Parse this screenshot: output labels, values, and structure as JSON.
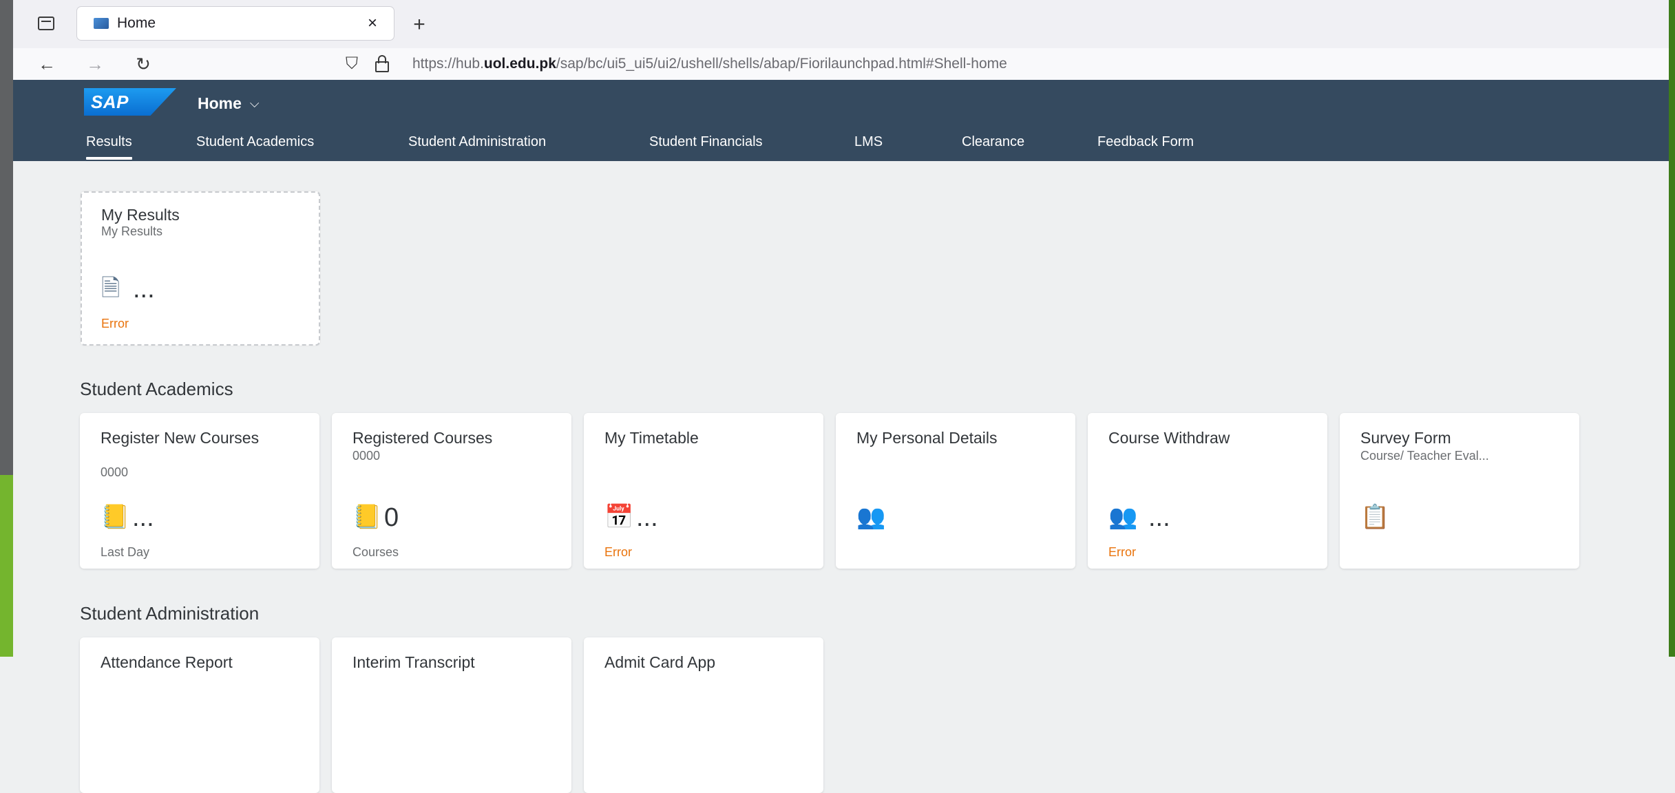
{
  "browser": {
    "tab_title": "Home",
    "tab_close": "×",
    "new_tab": "+",
    "back": "←",
    "forward": "→",
    "reload": "↻",
    "url_host": "https://hub.",
    "url_domain": "uol.edu.pk",
    "url_path": "/sap/bc/ui5_ui5/ui2/ushell/shells/abap/Fiorilaunchpad.html#Shell-home"
  },
  "shell": {
    "logo": "SAP",
    "home_label": "Home",
    "home_chevron": "⌵",
    "tabs": [
      {
        "label": "Results"
      },
      {
        "label": "Student Academics"
      },
      {
        "label": "Student Administration"
      },
      {
        "label": "Student Financials"
      },
      {
        "label": "LMS"
      },
      {
        "label": "Clearance"
      },
      {
        "label": "Feedback Form"
      }
    ]
  },
  "results_tile": {
    "title": "My Results",
    "subtitle": "My Results",
    "value": "...",
    "footer": "Error",
    "icon": "document-icon"
  },
  "sections": {
    "academics_title": "Student Academics",
    "administration_title": "Student Administration"
  },
  "academic_tiles": [
    {
      "title": "Register New Courses",
      "subtitle": "0000",
      "value": "...",
      "footer": "Last Day",
      "icon": "course-book-icon"
    },
    {
      "title": "Registered Courses",
      "subtitle": "0000",
      "value": "0",
      "footer": "Courses",
      "icon": "course-book-icon"
    },
    {
      "title": "My Timetable",
      "subtitle": "",
      "value": "...",
      "footer": "Error",
      "icon": "timetable-icon"
    },
    {
      "title": "My Personal Details",
      "subtitle": "",
      "value": "",
      "footer": "",
      "icon": "person-board-icon"
    },
    {
      "title": "Course Withdraw",
      "subtitle": "",
      "value": "...",
      "footer": "Error",
      "icon": "students-icon"
    },
    {
      "title": "Survey Form",
      "subtitle": "Course/ Teacher Eval...",
      "value": "",
      "footer": "",
      "icon": "survey-icon"
    }
  ],
  "admin_tiles": [
    {
      "title": "Attendance Report"
    },
    {
      "title": "Interim Transcript"
    },
    {
      "title": "Admit Card App"
    }
  ],
  "colors": {
    "shell_bg": "#354a5f",
    "error": "#e9730c",
    "page_bg": "#eef0f1"
  }
}
